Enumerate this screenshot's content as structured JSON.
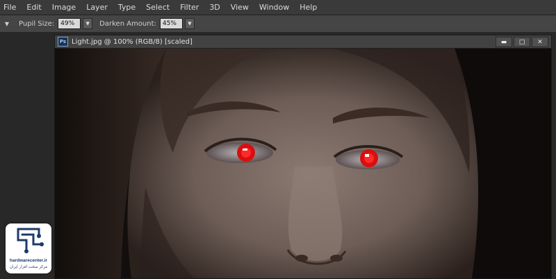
{
  "menubar": {
    "items": [
      {
        "label": "File"
      },
      {
        "label": "Edit"
      },
      {
        "label": "Image"
      },
      {
        "label": "Layer"
      },
      {
        "label": "Type"
      },
      {
        "label": "Select"
      },
      {
        "label": "Filter"
      },
      {
        "label": "3D"
      },
      {
        "label": "View"
      },
      {
        "label": "Window"
      },
      {
        "label": "Help"
      }
    ]
  },
  "options_bar": {
    "tool_preset_icon": "chevron-down-icon",
    "pupil_size_label": "Pupil Size:",
    "pupil_size_value": "49%",
    "darken_amount_label": "Darken Amount:",
    "darken_amount_value": "45%"
  },
  "document": {
    "app_icon_label": "Ps",
    "title": "Light.jpg @ 100% (RGB/8) [scaled]",
    "minimize_icon": "minimize-icon",
    "maximize_icon": "maximize-icon",
    "close_icon": "close-icon"
  },
  "photo": {
    "subject": "close-up of a girl's face with red-eye effect",
    "eye_color": "#ff1a1a"
  },
  "watermark": {
    "site": "hardwarecenter.ir",
    "subtitle": "مرکز سخت افزار ایران"
  },
  "colors": {
    "menubar_bg": "#3a3a3a",
    "options_bg": "#454545",
    "workspace_bg": "#282828",
    "brand_blue": "#1b3b6b"
  }
}
